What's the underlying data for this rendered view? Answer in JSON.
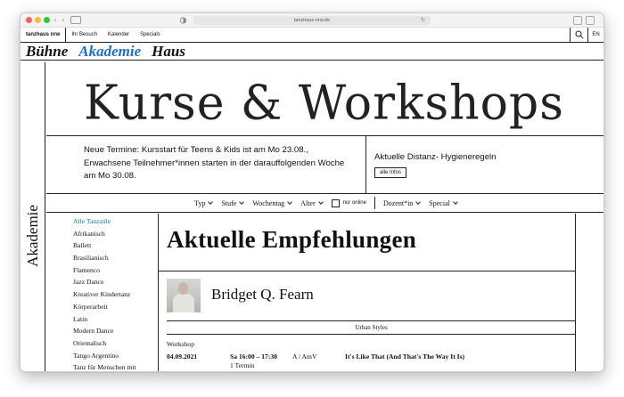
{
  "browser": {
    "url": "tanzhaus-nrw.de"
  },
  "sitenav": {
    "brand": "tanzhaus nrw",
    "items": [
      "Ihr Besuch",
      "Kalender",
      "Specials"
    ],
    "language": "EN"
  },
  "sections": {
    "items": [
      "Bühne",
      "Akademie",
      "Haus"
    ],
    "active": "Akademie"
  },
  "side_label": "Akademie",
  "hero": {
    "title": "Kurse & Workshops"
  },
  "news": {
    "text": "Neue Termine: Kursstart für Teens & Kids ist am Mo 23.08., Erwachsene Teilnehmer*innen starten in der darauffolgenden Woche am Mo 30.08.",
    "rules_title": "Aktuelle Distanz- Hygieneregeln",
    "rules_button": "alle Infos"
  },
  "filters": {
    "items": [
      "Typ",
      "Stufe",
      "Wochentag",
      "Alter"
    ],
    "online_label": "nur online",
    "items2": [
      "Dozent*in",
      "Special"
    ]
  },
  "styles": {
    "items": [
      "Alle Tanzstile",
      "Afrikanisch",
      "Ballett",
      "Brasilianisch",
      "Flamenco",
      "Jazz Dance",
      "Kreativer Kindertanz",
      "Körperarbeit",
      "Latin",
      "Modern Dance",
      "Orientalisch",
      "Tango Argentino",
      "Tanz für Menschen mit"
    ]
  },
  "recommendations": {
    "title": "Aktuelle Empfehlungen",
    "teacher": "Bridget Q. Fearn",
    "category": "Urban Styles",
    "kind": "Workshop",
    "date": "04.09.2021",
    "time": "Sa 16:00 – 17:30",
    "sessions": "1 Termin",
    "level": "A / AmV",
    "course_title": "It's Like That (And That's The Way It Is)"
  }
}
